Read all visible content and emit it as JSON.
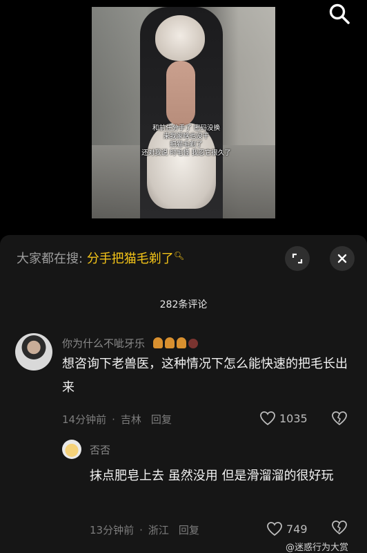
{
  "video": {
    "caption_lines": [
      "和前任分手了 密码没换",
      "来我家啥也没干",
      "把猫毛剃了",
      "还对我说 时毛怪 我忍它很久了"
    ]
  },
  "search": {
    "icon": "search-icon"
  },
  "hot_search": {
    "prefix": "大家都在搜:",
    "keyword": "分手把猫毛剃了",
    "keyword_icon": "search-icon"
  },
  "sheet": {
    "count_label": "282条评论"
  },
  "comments": [
    {
      "username": "你为什么不呲牙乐",
      "badges": [
        "badge-icon",
        "badge-icon",
        "badge-icon",
        "badge-icon"
      ],
      "text": "想咨询下老兽医，这种情况下怎么能快速的把毛长出来",
      "time": "14分钟前",
      "dot": "·",
      "location": "吉林",
      "reply_label": "回复",
      "likes": "1035"
    },
    {
      "username": "否否",
      "text": "抹点肥皂上去 虽然没用 但是滑溜溜的很好玩",
      "time": "13分钟前",
      "dot": "·",
      "location": "浙江",
      "reply_label": "回复",
      "likes": "749"
    }
  ],
  "watermark": "@迷惑行为大赏",
  "colors": {
    "accent": "#f5c518",
    "sheet_bg": "#161616",
    "muted": "#7d7d7d"
  }
}
